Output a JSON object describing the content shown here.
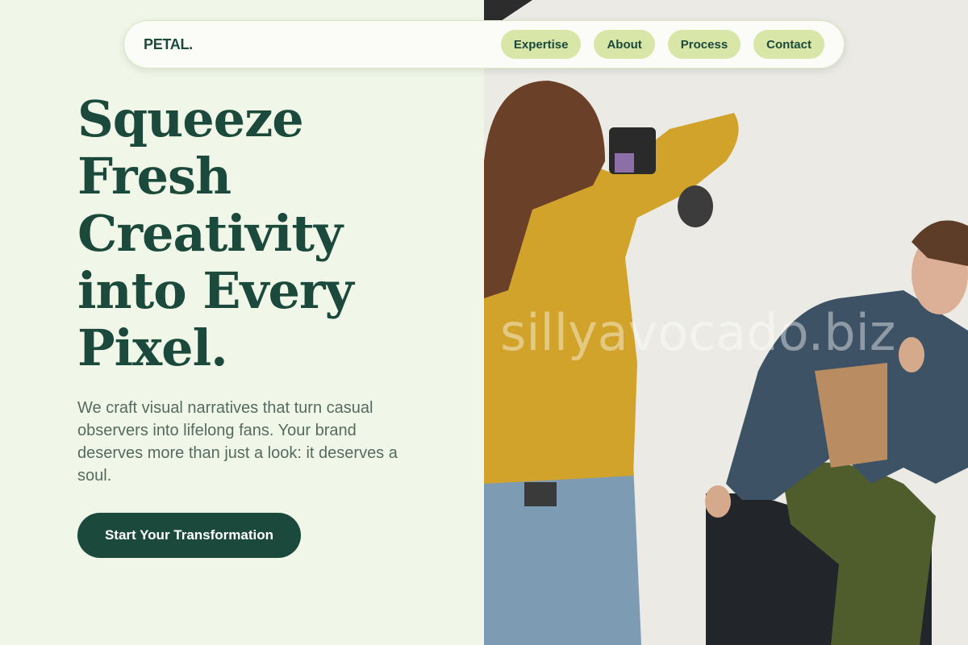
{
  "brand": {
    "logo": "PETAL."
  },
  "nav": {
    "items": [
      {
        "label": "Expertise"
      },
      {
        "label": "About"
      },
      {
        "label": "Process"
      },
      {
        "label": "Contact"
      }
    ]
  },
  "hero": {
    "headline_lines": [
      "Squeeze",
      "Fresh",
      "Creativity",
      "into Every",
      "Pixel."
    ],
    "subtext": "We craft visual narratives that turn casual observers into lifelong fans. Your brand deserves more than just a look: it deserves a soul.",
    "cta_label": "Start Your Transformation"
  },
  "image": {
    "description_icon": "photo-shoot-image",
    "watermark": "sillyavocado.biz"
  },
  "colors": {
    "background": "#f0f7e8",
    "primary": "#1b4a3c",
    "nav_pill": "#d8e6a8",
    "text_muted": "#556b60"
  }
}
